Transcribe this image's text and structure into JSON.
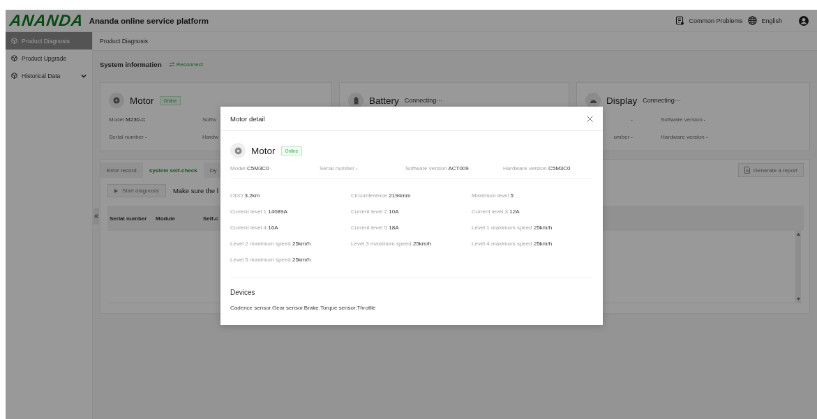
{
  "header": {
    "logo": "ANANDA",
    "title": "Ananda online service platform",
    "links": [
      {
        "kind": "help",
        "label": "Common Problems"
      },
      {
        "kind": "language",
        "label": "English"
      }
    ]
  },
  "sidebar": {
    "items": [
      {
        "label": "Product Diagnosis",
        "selected": true,
        "expandable": false
      },
      {
        "label": "Product Upgrade",
        "selected": false,
        "expandable": false
      },
      {
        "label": "Historical Data",
        "selected": false,
        "expandable": true
      }
    ]
  },
  "breadcrumb": "Product Diagnosis",
  "section": {
    "title": "System information",
    "action": "Reconnect"
  },
  "cards": [
    {
      "kind": "motor",
      "name": "Motor",
      "status": "Online",
      "online": true,
      "fields": [
        {
          "label": "Model",
          "value": "M230-C"
        },
        {
          "label": "Softw"
        },
        {
          "label": "Serial number",
          "value": "-"
        },
        {
          "label": "Hardw"
        }
      ]
    },
    {
      "kind": "battery",
      "name": "Battery",
      "status": "Connecting···",
      "online": false
    },
    {
      "kind": "display",
      "name": "Display",
      "status": "Connecting···",
      "online": false,
      "fields": [
        {
          "value": "-"
        },
        {
          "label": "Software version",
          "value": "-"
        },
        {
          "label": "umber",
          "value": "-"
        },
        {
          "label": "Hardware version",
          "value": "-"
        }
      ]
    }
  ],
  "tabs": [
    {
      "label": "Error record",
      "selected": false
    },
    {
      "label": "system self-check",
      "selected": true
    },
    {
      "label": "Dy",
      "selected": false
    }
  ],
  "diagnosis": {
    "button": "Start diagnosis",
    "disabled": true,
    "hint": "Make sure the l"
  },
  "report_button": {
    "label": "Generate a report",
    "disabled": true
  },
  "table": {
    "columns": [
      "Serial number",
      "Module",
      "Self-c"
    ]
  },
  "modal": {
    "title": "Motor detail",
    "name": "Motor",
    "status": "Online",
    "online": true,
    "info": [
      {
        "label": "Model",
        "value": "C5M3C0"
      },
      {
        "label": "Serial number",
        "value": "-"
      },
      {
        "label": "Software version",
        "value": "ACT009"
      },
      {
        "label": "Hardware version",
        "value": "C5M3C0"
      }
    ],
    "params": [
      {
        "label": "ODO",
        "value": "3.2km"
      },
      {
        "label": "Circumference",
        "value": "2194mm"
      },
      {
        "label": "Maximum level",
        "value": "5"
      },
      {
        "label": "Current level 1",
        "value": "14089A"
      },
      {
        "label": "Current level 2",
        "value": "10A"
      },
      {
        "label": "Current level 3",
        "value": "12A"
      },
      {
        "label": "Current level 4",
        "value": "16A"
      },
      {
        "label": "Current level 5",
        "value": "18A"
      },
      {
        "label": "Level 1 maximum speed",
        "value": "25km/h"
      },
      {
        "label": "Level 2 maximum speed",
        "value": "25km/h"
      },
      {
        "label": "Level 3 maximum speed",
        "value": "25km/h"
      },
      {
        "label": "Level 4 maximum speed",
        "value": "25km/h"
      },
      {
        "label": "Level 5 maximum speed",
        "value": "25km/h"
      }
    ],
    "devices_title": "Devices",
    "devices": "Cadence sensor.Gear sensor.Brake.Torque sensor.Throttle"
  }
}
